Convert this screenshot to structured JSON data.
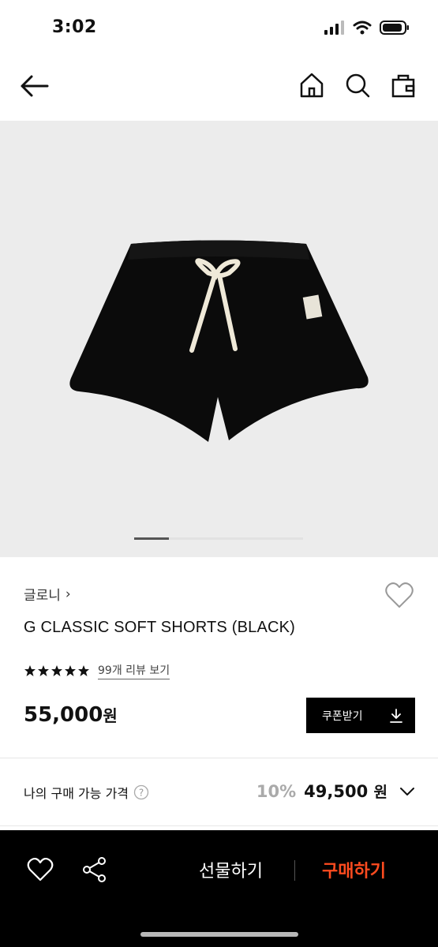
{
  "status_bar": {
    "time": "3:02"
  },
  "icons": {
    "back": "arrow-left-icon",
    "home": "home-icon",
    "search": "search-icon",
    "cart": "shopping-bag-icon",
    "wish": "heart-icon",
    "share": "share-icon",
    "download": "download-icon",
    "help": "question-icon",
    "expand": "chevron-down-icon"
  },
  "product": {
    "brand": "글로니",
    "brand_chevron": "›",
    "name": "G CLASSIC SOFT SHORTS (BLACK)",
    "rating_stars": 5,
    "review_link": "99개 리뷰 보기",
    "price": "55,000",
    "price_unit": "원",
    "carousel_position": 1,
    "image_alt": "black shorts"
  },
  "coupon": {
    "label": "쿠폰받기"
  },
  "my_price": {
    "label": "나의 구매 가능 가격",
    "help": "?",
    "discount": "10%",
    "price": "49,500",
    "unit": "원"
  },
  "bottom_bar": {
    "gift_label": "선물하기",
    "buy_label": "구매하기"
  },
  "colors": {
    "buy_accent": "#ff4b1f",
    "bottom_bar_bg": "#000000",
    "image_bg": "#ececec",
    "discount": "#aaaaaa"
  }
}
